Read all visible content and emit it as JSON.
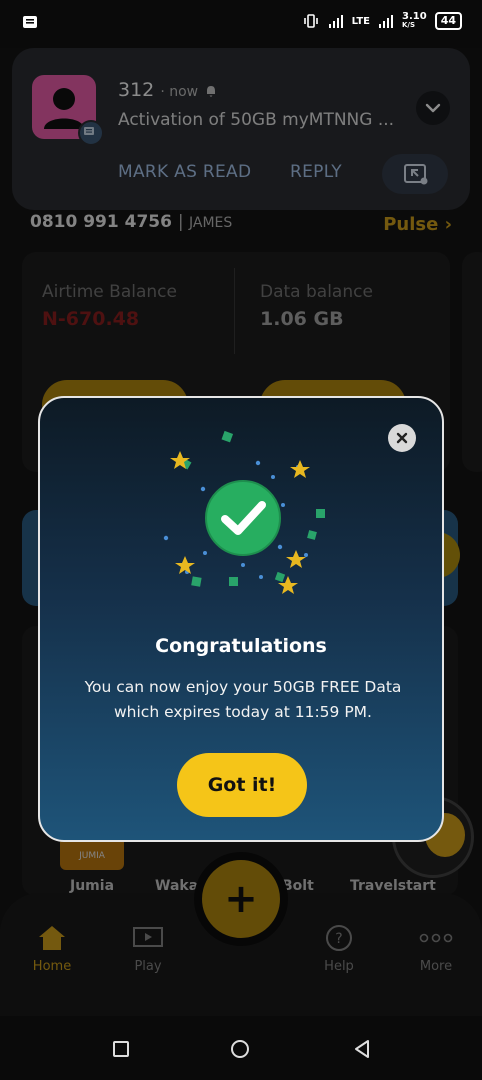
{
  "statusbar": {
    "network": "LTE",
    "speed_value": "3.10",
    "speed_unit": "K/S",
    "battery": "44"
  },
  "notification": {
    "sender": "312",
    "time": "now",
    "body": "Activation of 50GB myMTNNG ...",
    "actions": [
      "MARK AS READ",
      "REPLY"
    ]
  },
  "account": {
    "phone": "0810 991 4756",
    "name": "JAMES",
    "pulse_label": "Pulse",
    "airtime_label": "Airtime Balance",
    "airtime_value": "N-670.48",
    "data_label": "Data balance",
    "data_value": "1.06 GB"
  },
  "services": [
    {
      "label": "Jumia",
      "tile_text": "JUMIA"
    },
    {
      "label": "Waka"
    },
    {
      "label": "Bolt"
    },
    {
      "label": "Travelstart"
    }
  ],
  "bottom_nav": [
    {
      "label": "Home",
      "icon": "home-icon",
      "active": true
    },
    {
      "label": "Play",
      "icon": "play-icon"
    },
    {
      "label": "Help",
      "icon": "help-icon"
    },
    {
      "label": "More",
      "icon": "more-icon"
    }
  ],
  "fab_symbol": "+",
  "modal": {
    "title": "Congratulations",
    "message": "You can now enjoy your 50GB FREE Data which expires today at 11:59 PM.",
    "button_label": "Got it!"
  },
  "colors": {
    "accent": "#f5c518",
    "success": "#27ae60",
    "airtime_negative": "#c0392b"
  }
}
